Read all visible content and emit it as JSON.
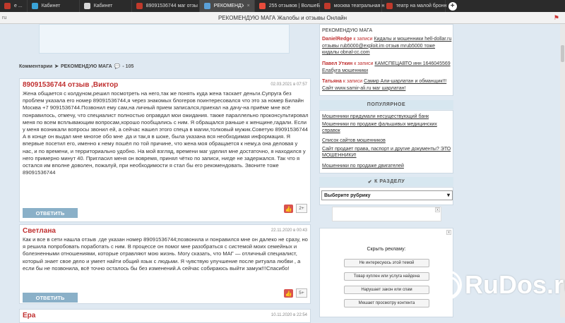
{
  "browser": {
    "tabs": [
      {
        "label": "е ...",
        "color": "#c0392b",
        "active": false
      },
      {
        "label": "Кабинет",
        "color": "#3aa3d8",
        "active": false
      },
      {
        "label": "Кабинет",
        "color": "#d8d8d8",
        "active": false
      },
      {
        "label": "89091536744 маг отзы",
        "color": "#c0392b",
        "active": false
      },
      {
        "label": "РЕКОМЕНДУЮ МАГ",
        "color": "#5aa0d8",
        "active": true
      },
      {
        "label": "255 отзывов | ВолшеБ",
        "color": "#e74c3c",
        "active": false
      },
      {
        "label": "москва театральная н",
        "color": "#c0392b",
        "active": false
      },
      {
        "label": "театр на малой бронн",
        "color": "#c0392b",
        "active": false
      }
    ],
    "new_tab": "+",
    "domain": "ru",
    "page_title": "РЕКОМЕНДУЮ МАГА Жалобы и отзывы Онлайн"
  },
  "breadcrumbs": {
    "label": "Комментарии",
    "arrow": "➤",
    "page": "РЕКОМЕНДУЮ МАГА",
    "count": "- 105"
  },
  "comments": [
    {
      "name": "89091536744 отзыв ,Виктор",
      "date": "02.03.2021 в 07:57",
      "text": "Жена общается с колдуном,решил посмотреть на него,так же понять куда жена таскает деньги.Супруга без проблем указала его номер 89091536744,я через знакомых блогеров поинтересовался что это за номер Билайн Москва +7 9091536744.Позвонил ему сам,на личный прием записался,приехал на дачу-на приёме мне всё понравилось, отмечу, что специалист полностью оправдал мои ожидания. также параллельно проконсультировал меня по всем всплывающим вопросам,хорошо пообщались с ним. Я обращался раньше к женщине,гадали. Если у меня возникали вопросы звонил ей, а сейчас нашел этого спеца в магии,толковый мужик.Советую 89091536744\nА в конце он выдал мне многое обо мне .да и так,я в шоке, была указана вся необходимая информация. Я впервые посетил его, именно к нему пошёл по той причине, что жена моя обращается к нему,а она деловая у нас, и по времени, и территориально удобно. На мой взгляд, времени маг уделил мне достаточно, я находился у него примерно минут 40. Пригласил меня он вовремя, принял чётко по записи, нигде не задержался. Так что я остался им вполне доволен, пожалуй, при необходимости я стал бы его рекомендовать. Звоните тоже 89091536744",
      "reply": "ОТВЕТИТЬ",
      "likes": "2+"
    },
    {
      "name": "Светлана",
      "date": "22.11.2020 в 00:43",
      "text": "Как и все в сети нашла отзыв ,где указан номер 89091536744;позвонила и понравился мне он далеко не сразу, но я решила попробовать поработать с ним. В процессе он помог мне разобраться с системой моих семейных и болезненными отношениями, которые отравляют мою жизнь. Могу сказать, что МАГ — отличный специалист, который знает свое дело и умеет найти общий язык с людьми. Я чувствую улучшение после ритуала любви , а если бы не позвонила, всё точно осталось бы без изменений.А сейчас собираюсь выйти замуж!!!Спасибо!",
      "reply": "ОТВЕТИТЬ",
      "likes": "5+"
    },
    {
      "name": "Ера",
      "date": "10.11.2020 в 22:54",
      "text": "",
      "reply": "",
      "likes": ""
    }
  ],
  "recent": {
    "section": "РЕКОМЕНДУЮ МАГА",
    "items": [
      {
        "user": "DanielRedge",
        "sep": "к записи",
        "target": "Кидалы и мошенники hell-dollar.ru отзывы rub5000@exploit.im отзыв mrub5000 тоже кидалы obnal-cc.com"
      },
      {
        "user": "Павел Уткин",
        "sep": "к записи",
        "target": "КАМСПЕЦАВТО инн 1646045569 Елабуга мошенники"
      },
      {
        "user": "Татьяна",
        "sep": "к записи",
        "target": "Самир Али-шарлатан и обманщик!!!Сайт www.samir-ali.ru маг шарлатан!"
      }
    ]
  },
  "popular": {
    "header": "ПОПУЛЯРНОЕ",
    "links": [
      "Мошенники придумали несуществующий банк",
      "Мошенники по продаже фальшивых медицинских справок",
      "Список сайтов мошенников",
      "Сайт продает права, паспорт и другие документы? ЭТО МОШЕННИКИ!",
      "Мошенники по продаже двигателей"
    ]
  },
  "section": {
    "header": "К РАЗДЕЛУ",
    "select_value": "Выберите рубрику"
  },
  "hide_ad": {
    "title": "Скрыть рекламу:",
    "options": [
      "Не интересуюсь этой темой",
      "Товар куплен или услуга найдена",
      "Нарушает закон или спам",
      "Мешает просмотру контента"
    ],
    "close": "x"
  },
  "watermark": {
    "text": "RuDos.ru"
  }
}
